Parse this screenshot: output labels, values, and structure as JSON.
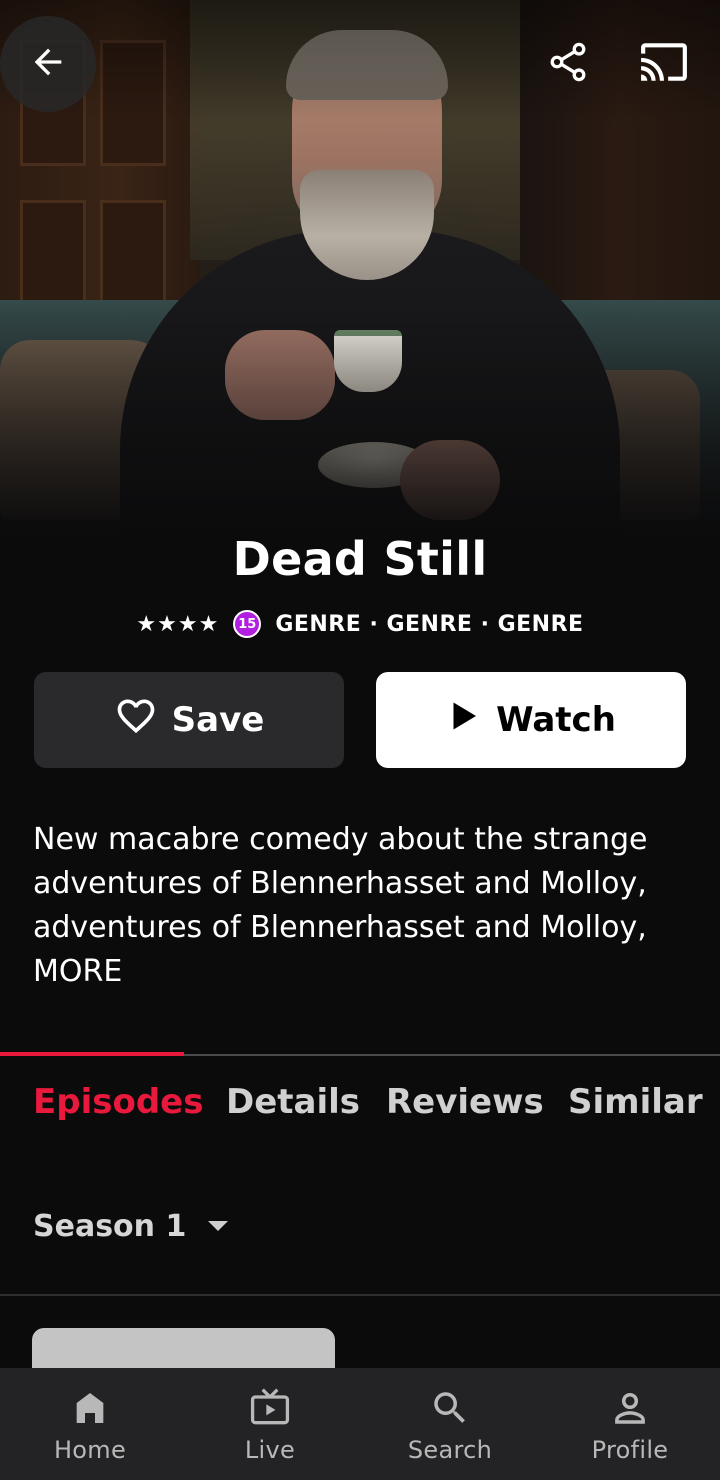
{
  "header": {
    "back_icon": "arrow-left-icon",
    "share_icon": "share-icon",
    "cast_icon": "cast-icon"
  },
  "show": {
    "title": "Dead Still",
    "stars": "★★★★",
    "age_rating": "15",
    "genres": "GENRE · GENRE · GENRE",
    "description_lines": [
      "New macabre comedy about the strange",
      "adventures of Blennerhasset and Molloy,",
      "adventures of Blennerhasset and Molloy,"
    ],
    "more_label": "MORE"
  },
  "actions": {
    "save_label": "Save",
    "watch_label": "Watch"
  },
  "tabs": [
    {
      "label": "Episodes",
      "active": true
    },
    {
      "label": "Details",
      "active": false
    },
    {
      "label": "Reviews",
      "active": false
    },
    {
      "label": "Similar",
      "active": false
    }
  ],
  "season": {
    "selected": "Season 1"
  },
  "bottom_nav": [
    {
      "label": "Home",
      "icon": "home-icon"
    },
    {
      "label": "Live",
      "icon": "tv-icon"
    },
    {
      "label": "Search",
      "icon": "search-icon"
    },
    {
      "label": "Profile",
      "icon": "profile-icon"
    }
  ],
  "colors": {
    "accent": "#e8193c",
    "rating_badge": "#b21fe0",
    "background": "#0b0b0c",
    "nav_background": "#232325"
  }
}
